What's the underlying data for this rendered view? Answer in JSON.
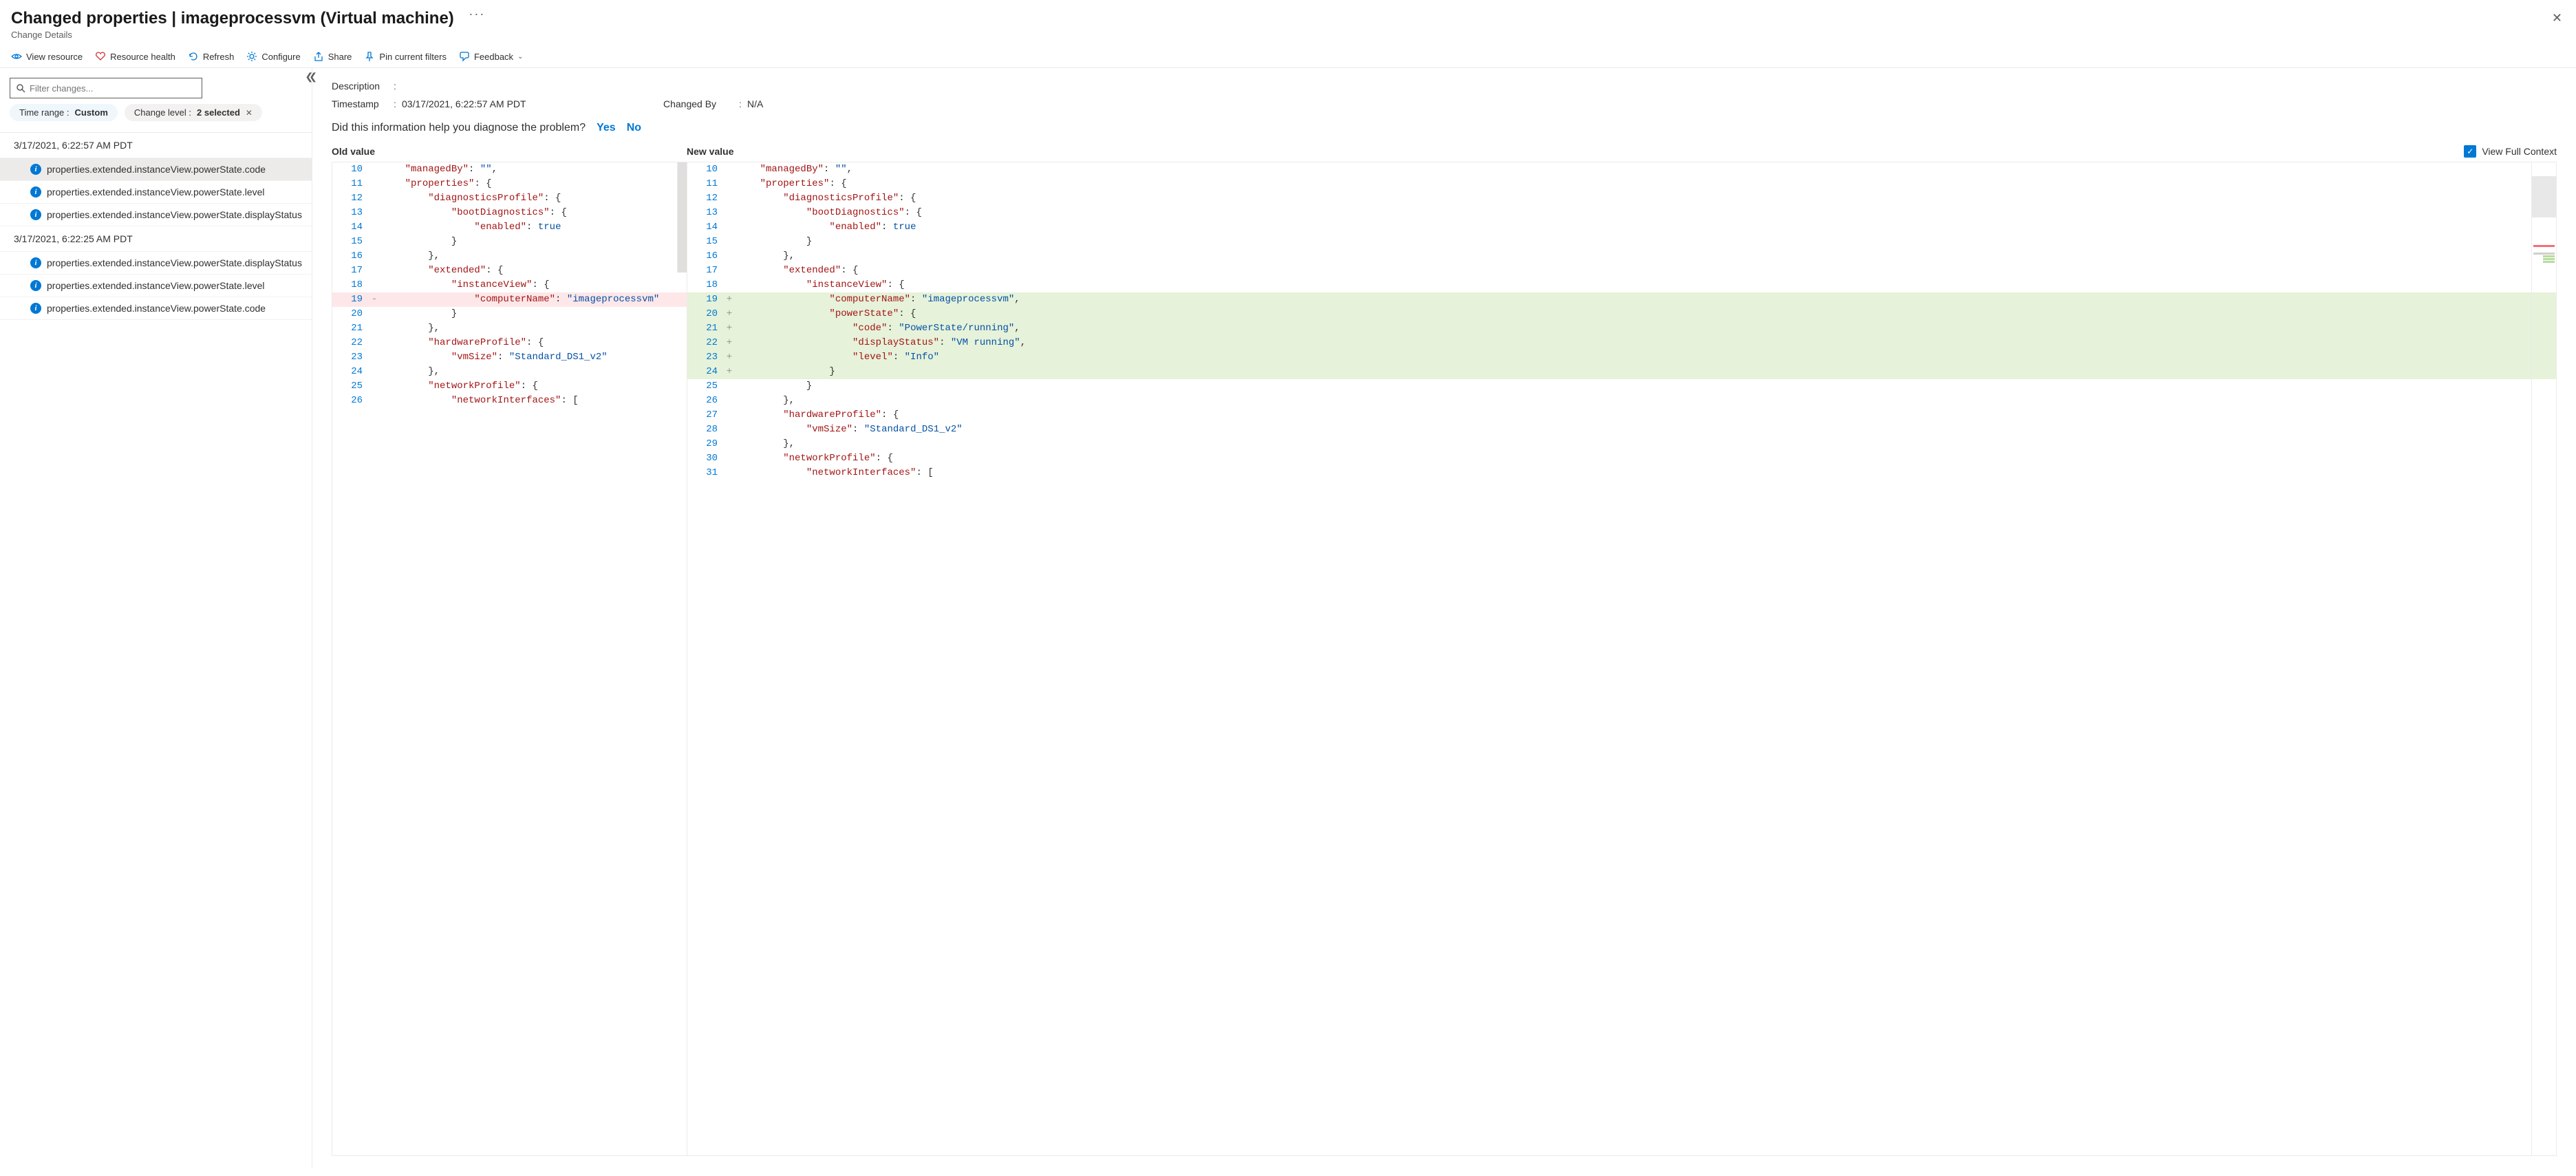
{
  "header": {
    "title": "Changed properties | imageprocessvm (Virtual machine)",
    "subtitle": "Change Details"
  },
  "toolbar": {
    "view_resource": "View resource",
    "resource_health": "Resource health",
    "refresh": "Refresh",
    "configure": "Configure",
    "share": "Share",
    "pin": "Pin current filters",
    "feedback": "Feedback"
  },
  "sidebar": {
    "filter_placeholder": "Filter changes...",
    "pill_time_label": "Time range : ",
    "pill_time_value": "Custom",
    "pill_level_label": "Change level : ",
    "pill_level_value": "2 selected",
    "groups": [
      {
        "timestamp": "3/17/2021, 6:22:57 AM PDT",
        "items": [
          {
            "path": "properties.extended.instanceView.powerState.code",
            "selected": true
          },
          {
            "path": "properties.extended.instanceView.powerState.level",
            "selected": false
          },
          {
            "path": "properties.extended.instanceView.powerState.displayStatus",
            "selected": false
          }
        ]
      },
      {
        "timestamp": "3/17/2021, 6:22:25 AM PDT",
        "items": [
          {
            "path": "properties.extended.instanceView.powerState.displayStatus",
            "selected": false
          },
          {
            "path": "properties.extended.instanceView.powerState.level",
            "selected": false
          },
          {
            "path": "properties.extended.instanceView.powerState.code",
            "selected": false
          }
        ]
      }
    ]
  },
  "main": {
    "description_label": "Description",
    "description_value": "",
    "timestamp_label": "Timestamp",
    "timestamp_value": "03/17/2021, 6:22:57 AM PDT",
    "changedby_label": "Changed By",
    "changedby_value": "N/A",
    "question": "Did this information help you diagnose the problem?",
    "yes": "Yes",
    "no": "No",
    "old_value_label": "Old value",
    "new_value_label": "New value",
    "view_full_context": "View Full Context"
  },
  "diff": {
    "left": [
      {
        "n": 10,
        "m": "",
        "t": [
          [
            "    ",
            ""
          ],
          [
            "\"managedBy\"",
            "k"
          ],
          [
            ": ",
            ""
          ],
          [
            "\"\"",
            "v-str"
          ],
          [
            ",",
            ""
          ]
        ]
      },
      {
        "n": 11,
        "m": "",
        "t": [
          [
            "    ",
            ""
          ],
          [
            "\"properties\"",
            "k"
          ],
          [
            ": {",
            ""
          ]
        ]
      },
      {
        "n": 12,
        "m": "",
        "t": [
          [
            "        ",
            ""
          ],
          [
            "\"diagnosticsProfile\"",
            "k"
          ],
          [
            ": {",
            ""
          ]
        ]
      },
      {
        "n": 13,
        "m": "",
        "t": [
          [
            "            ",
            ""
          ],
          [
            "\"bootDiagnostics\"",
            "k"
          ],
          [
            ": {",
            ""
          ]
        ]
      },
      {
        "n": 14,
        "m": "",
        "t": [
          [
            "                ",
            ""
          ],
          [
            "\"enabled\"",
            "k"
          ],
          [
            ": ",
            ""
          ],
          [
            "true",
            "v-kw"
          ]
        ]
      },
      {
        "n": 15,
        "m": "",
        "t": [
          [
            "            }",
            ""
          ]
        ]
      },
      {
        "n": 16,
        "m": "",
        "t": [
          [
            "        },",
            ""
          ]
        ]
      },
      {
        "n": 17,
        "m": "",
        "t": [
          [
            "        ",
            ""
          ],
          [
            "\"extended\"",
            "k"
          ],
          [
            ": {",
            ""
          ]
        ]
      },
      {
        "n": 18,
        "m": "",
        "t": [
          [
            "            ",
            ""
          ],
          [
            "\"instanceView\"",
            "k"
          ],
          [
            ": {",
            ""
          ]
        ]
      },
      {
        "n": 19,
        "m": "removed",
        "gut": "-",
        "t": [
          [
            "                ",
            ""
          ],
          [
            "\"computerName\"",
            "k"
          ],
          [
            ": ",
            ""
          ],
          [
            "\"imageprocessvm\"",
            "v-str"
          ]
        ]
      },
      {
        "n": "",
        "m": "hatch",
        "t": [
          [
            "",
            ""
          ]
        ]
      },
      {
        "n": "",
        "m": "hatch",
        "t": [
          [
            "",
            ""
          ]
        ]
      },
      {
        "n": "",
        "m": "hatch",
        "t": [
          [
            "",
            ""
          ]
        ]
      },
      {
        "n": "",
        "m": "hatch",
        "t": [
          [
            "",
            ""
          ]
        ]
      },
      {
        "n": "",
        "m": "hatch",
        "t": [
          [
            "",
            ""
          ]
        ]
      },
      {
        "n": 20,
        "m": "",
        "t": [
          [
            "            }",
            ""
          ]
        ]
      },
      {
        "n": 21,
        "m": "",
        "t": [
          [
            "        },",
            ""
          ]
        ]
      },
      {
        "n": 22,
        "m": "",
        "t": [
          [
            "        ",
            ""
          ],
          [
            "\"hardwareProfile\"",
            "k"
          ],
          [
            ": {",
            ""
          ]
        ]
      },
      {
        "n": 23,
        "m": "",
        "t": [
          [
            "            ",
            ""
          ],
          [
            "\"vmSize\"",
            "k"
          ],
          [
            ": ",
            ""
          ],
          [
            "\"Standard_DS1_v2\"",
            "v-str"
          ]
        ]
      },
      {
        "n": 24,
        "m": "",
        "t": [
          [
            "        },",
            ""
          ]
        ]
      },
      {
        "n": 25,
        "m": "",
        "t": [
          [
            "        ",
            ""
          ],
          [
            "\"networkProfile\"",
            "k"
          ],
          [
            ": {",
            ""
          ]
        ]
      },
      {
        "n": 26,
        "m": "",
        "t": [
          [
            "            ",
            ""
          ],
          [
            "\"networkInterfaces\"",
            "k"
          ],
          [
            ": [",
            ""
          ]
        ]
      }
    ],
    "right": [
      {
        "n": 10,
        "m": "",
        "t": [
          [
            "    ",
            ""
          ],
          [
            "\"managedBy\"",
            "k"
          ],
          [
            ": ",
            ""
          ],
          [
            "\"\"",
            "v-str"
          ],
          [
            ",",
            ""
          ]
        ]
      },
      {
        "n": 11,
        "m": "",
        "t": [
          [
            "    ",
            ""
          ],
          [
            "\"properties\"",
            "k"
          ],
          [
            ": {",
            ""
          ]
        ]
      },
      {
        "n": 12,
        "m": "",
        "t": [
          [
            "        ",
            ""
          ],
          [
            "\"diagnosticsProfile\"",
            "k"
          ],
          [
            ": {",
            ""
          ]
        ]
      },
      {
        "n": 13,
        "m": "",
        "t": [
          [
            "            ",
            ""
          ],
          [
            "\"bootDiagnostics\"",
            "k"
          ],
          [
            ": {",
            ""
          ]
        ]
      },
      {
        "n": 14,
        "m": "",
        "t": [
          [
            "                ",
            ""
          ],
          [
            "\"enabled\"",
            "k"
          ],
          [
            ": ",
            ""
          ],
          [
            "true",
            "v-kw"
          ]
        ]
      },
      {
        "n": 15,
        "m": "",
        "t": [
          [
            "            }",
            ""
          ]
        ]
      },
      {
        "n": 16,
        "m": "",
        "t": [
          [
            "        },",
            ""
          ]
        ]
      },
      {
        "n": 17,
        "m": "",
        "t": [
          [
            "        ",
            ""
          ],
          [
            "\"extended\"",
            "k"
          ],
          [
            ": {",
            ""
          ]
        ]
      },
      {
        "n": 18,
        "m": "",
        "t": [
          [
            "            ",
            ""
          ],
          [
            "\"instanceView\"",
            "k"
          ],
          [
            ": {",
            ""
          ]
        ]
      },
      {
        "n": 19,
        "m": "added",
        "gut": "+",
        "t": [
          [
            "                ",
            ""
          ],
          [
            "\"computerName\"",
            "k"
          ],
          [
            ": ",
            ""
          ],
          [
            "\"imageprocessvm\"",
            "v-str"
          ],
          [
            ",",
            ""
          ]
        ]
      },
      {
        "n": 20,
        "m": "added",
        "gut": "+",
        "t": [
          [
            "                ",
            ""
          ],
          [
            "\"powerState\"",
            "k"
          ],
          [
            ": {",
            ""
          ]
        ]
      },
      {
        "n": 21,
        "m": "added",
        "gut": "+",
        "t": [
          [
            "                    ",
            ""
          ],
          [
            "\"code\"",
            "k"
          ],
          [
            ": ",
            ""
          ],
          [
            "\"PowerState/running\"",
            "v-str"
          ],
          [
            ",",
            ""
          ]
        ]
      },
      {
        "n": 22,
        "m": "added",
        "gut": "+",
        "t": [
          [
            "                    ",
            ""
          ],
          [
            "\"displayStatus\"",
            "k"
          ],
          [
            ": ",
            ""
          ],
          [
            "\"VM running\"",
            "v-str"
          ],
          [
            ",",
            ""
          ]
        ]
      },
      {
        "n": 23,
        "m": "added",
        "gut": "+",
        "t": [
          [
            "                    ",
            ""
          ],
          [
            "\"level\"",
            "k"
          ],
          [
            ": ",
            ""
          ],
          [
            "\"Info\"",
            "v-str"
          ]
        ]
      },
      {
        "n": 24,
        "m": "added",
        "gut": "+",
        "t": [
          [
            "                }",
            ""
          ]
        ]
      },
      {
        "n": 25,
        "m": "",
        "t": [
          [
            "            }",
            ""
          ]
        ]
      },
      {
        "n": 26,
        "m": "",
        "t": [
          [
            "        },",
            ""
          ]
        ]
      },
      {
        "n": 27,
        "m": "",
        "t": [
          [
            "        ",
            ""
          ],
          [
            "\"hardwareProfile\"",
            "k"
          ],
          [
            ": {",
            ""
          ]
        ]
      },
      {
        "n": 28,
        "m": "",
        "t": [
          [
            "            ",
            ""
          ],
          [
            "\"vmSize\"",
            "k"
          ],
          [
            ": ",
            ""
          ],
          [
            "\"Standard_DS1_v2\"",
            "v-str"
          ]
        ]
      },
      {
        "n": 29,
        "m": "",
        "t": [
          [
            "        },",
            ""
          ]
        ]
      },
      {
        "n": 30,
        "m": "",
        "t": [
          [
            "        ",
            ""
          ],
          [
            "\"networkProfile\"",
            "k"
          ],
          [
            ": {",
            ""
          ]
        ]
      },
      {
        "n": 31,
        "m": "",
        "t": [
          [
            "            ",
            ""
          ],
          [
            "\"networkInterfaces\"",
            "k"
          ],
          [
            ": [",
            ""
          ]
        ]
      }
    ]
  }
}
